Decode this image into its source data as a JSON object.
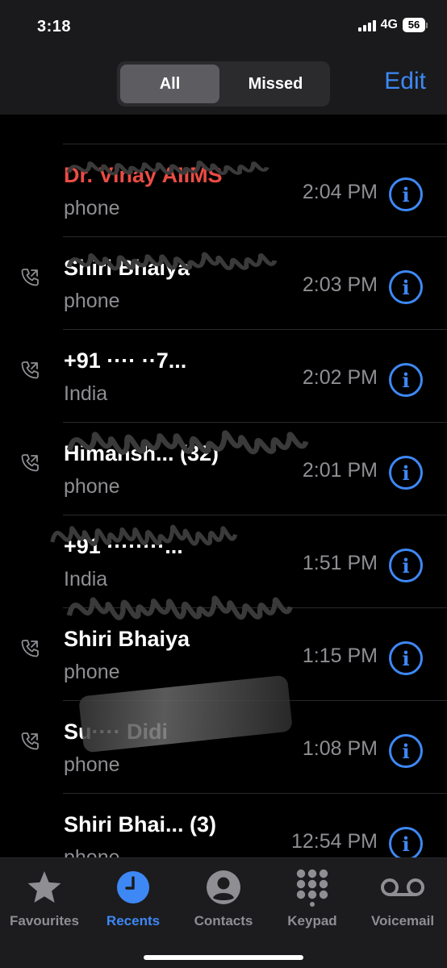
{
  "status": {
    "time": "3:18",
    "network": "4G",
    "battery": "56"
  },
  "header": {
    "segments": [
      "All",
      "Missed"
    ],
    "selected_segment": "All",
    "edit_label": "Edit"
  },
  "calls": [
    {
      "name": "",
      "subtitle": "phone",
      "time": "",
      "missed": false,
      "outgoing": false
    },
    {
      "name": "Dr. Vinay AIIMS",
      "subtitle": "phone",
      "time": "2:04 PM",
      "missed": true,
      "outgoing": false
    },
    {
      "name": "Shiri Bhaiya",
      "subtitle": "phone",
      "time": "2:03 PM",
      "missed": false,
      "outgoing": true
    },
    {
      "name": "+91 ···· ··7...",
      "subtitle": "India",
      "time": "2:02 PM",
      "missed": false,
      "outgoing": true
    },
    {
      "name": "Himansh...  (32)",
      "subtitle": "phone",
      "time": "2:01 PM",
      "missed": false,
      "outgoing": true
    },
    {
      "name": "+91 ········...",
      "subtitle": "India",
      "time": "1:51 PM",
      "missed": false,
      "outgoing": false
    },
    {
      "name": "Shiri Bhaiya",
      "subtitle": "phone",
      "time": "1:15 PM",
      "missed": false,
      "outgoing": true
    },
    {
      "name": "Su···· Didi",
      "subtitle": "phone",
      "time": "1:08 PM",
      "missed": false,
      "outgoing": true
    },
    {
      "name": "Shiri Bhai... (3)",
      "subtitle": "phone",
      "time": "12:54 PM",
      "missed": false,
      "outgoing": false
    }
  ],
  "tabs": [
    {
      "label": "Favourites",
      "icon": "star-icon",
      "active": false
    },
    {
      "label": "Recents",
      "icon": "clock-icon",
      "active": true
    },
    {
      "label": "Contacts",
      "icon": "person-circle-icon",
      "active": false
    },
    {
      "label": "Keypad",
      "icon": "keypad-icon",
      "active": false
    },
    {
      "label": "Voicemail",
      "icon": "voicemail-icon",
      "active": false
    }
  ],
  "colors": {
    "accent": "#3e88f5",
    "missed": "#eb4c44",
    "secondary": "#8e8e93"
  }
}
